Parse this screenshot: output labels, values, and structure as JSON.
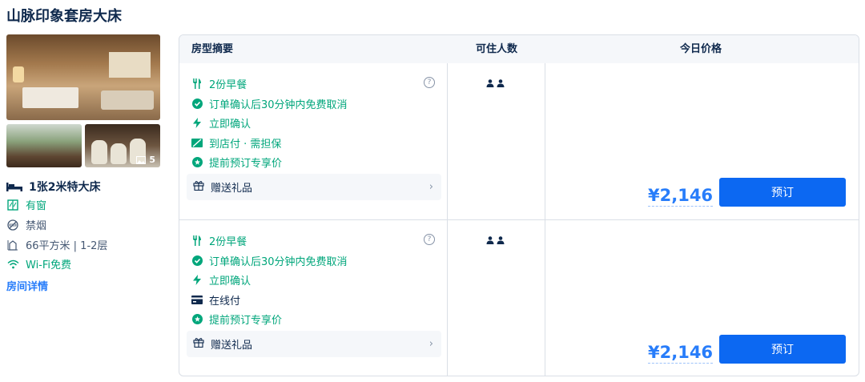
{
  "room": {
    "title": "山脉印象套房大床",
    "photo_count": "5",
    "bed": "1张2米特大床",
    "features": [
      {
        "icon": "window-icon",
        "label": "有窗",
        "color": "#00a67b"
      },
      {
        "icon": "no-smoking-icon",
        "label": "禁烟",
        "color": "#455873"
      },
      {
        "icon": "area-icon",
        "label": "66平方米 | 1-2层",
        "color": "#455873"
      },
      {
        "icon": "wifi-icon",
        "label": "Wi-Fi免费",
        "color": "#00a67b"
      }
    ],
    "detail_link": "房间详情"
  },
  "table": {
    "headers": {
      "summary": "房型摘要",
      "occupancy": "可住人数",
      "price": "今日价格"
    },
    "rows": [
      {
        "policies": [
          {
            "icon": "breakfast-icon",
            "label": "2份早餐",
            "color": "#00a67b"
          },
          {
            "icon": "check-circle-icon",
            "label": "订单确认后30分钟内免费取消",
            "color": "#00a67b"
          },
          {
            "icon": "lightning-icon",
            "label": "立即确认",
            "color": "#00a67b"
          },
          {
            "icon": "pay-at-hotel-icon",
            "label": "到店付 · 需担保",
            "color": "#00a67b"
          },
          {
            "icon": "star-badge-icon",
            "label": "提前预订专享价",
            "color": "#00a67b"
          }
        ],
        "gift": "赠送礼品",
        "guests": 2,
        "price": "¥2,146",
        "book_label": "预订"
      },
      {
        "policies": [
          {
            "icon": "breakfast-icon",
            "label": "2份早餐",
            "color": "#00a67b"
          },
          {
            "icon": "check-circle-icon",
            "label": "订单确认后30分钟内免费取消",
            "color": "#00a67b"
          },
          {
            "icon": "lightning-icon",
            "label": "立即确认",
            "color": "#00a67b"
          },
          {
            "icon": "card-icon",
            "label": "在线付",
            "color": "#0f294d"
          },
          {
            "icon": "star-badge-icon",
            "label": "提前预订专享价",
            "color": "#00a67b"
          }
        ],
        "gift": "赠送礼品",
        "guests": 2,
        "price": "¥2,146",
        "book_label": "预订"
      }
    ]
  },
  "colors": {
    "accent": "#287dfa",
    "button": "#0c68f2",
    "green": "#00a67b",
    "text": "#0f294d"
  }
}
